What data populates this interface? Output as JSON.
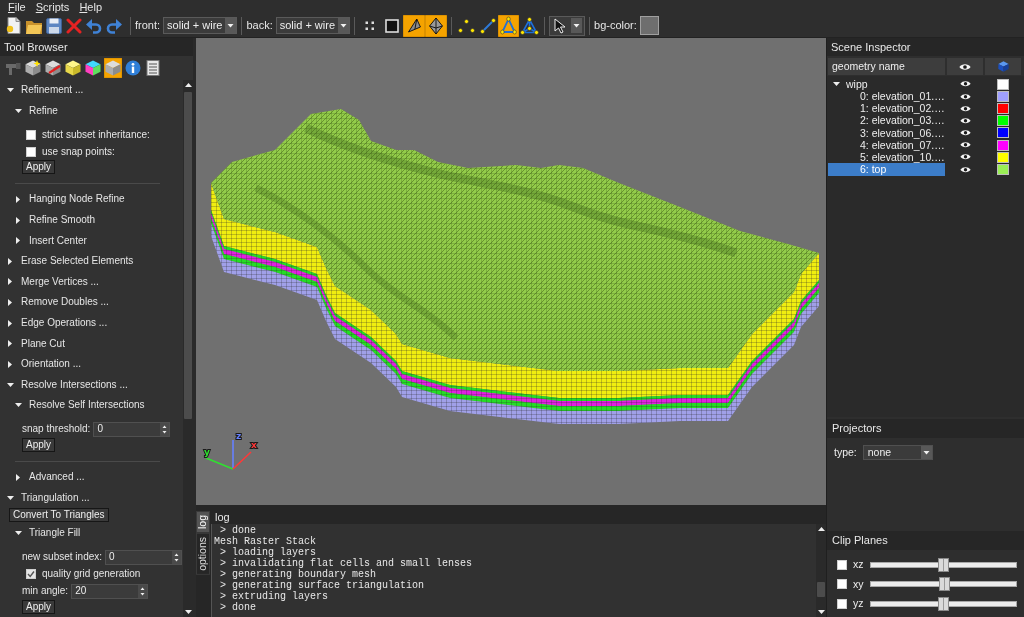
{
  "menu": [
    {
      "label": "File"
    },
    {
      "label": "Scripts"
    },
    {
      "label": "Help"
    }
  ],
  "toolbar": {
    "front": {
      "label": "front:",
      "value": "solid + wire"
    },
    "back": {
      "label": "back:",
      "value": "solid + wire"
    },
    "display_modes": [
      {
        "selected": false
      },
      {
        "selected": false
      },
      {
        "selected": true
      },
      {
        "selected": true
      }
    ],
    "selection_modes": [
      {
        "selected": false
      },
      {
        "selected": false
      },
      {
        "selected": true
      },
      {
        "selected": false
      }
    ],
    "bg_color_label": "bg-color:"
  },
  "tool_browser": {
    "title": "Tool Browser",
    "tool_tabs": [
      {
        "selected": false
      },
      {
        "selected": false
      },
      {
        "selected": false
      },
      {
        "selected": false
      },
      {
        "selected": false
      },
      {
        "selected": true
      },
      {
        "selected": false
      },
      {
        "selected": false
      }
    ],
    "tree": [
      {
        "kind": "group",
        "label": "Refinement ...",
        "expanded": true,
        "children": [
          {
            "kind": "group",
            "label": "Refine",
            "expanded": true,
            "children": [
              {
                "kind": "checkbox",
                "label": "strict subset inheritance:",
                "checked": false
              },
              {
                "kind": "checkbox",
                "label": "use snap points:",
                "checked": false
              },
              {
                "kind": "button",
                "label": "Apply"
              }
            ]
          },
          {
            "kind": "separator"
          },
          {
            "kind": "group",
            "label": "Hanging Node Refine",
            "expanded": false
          },
          {
            "kind": "group",
            "label": "Refine Smooth",
            "expanded": false
          },
          {
            "kind": "group",
            "label": "Insert Center",
            "expanded": false
          }
        ]
      },
      {
        "kind": "group",
        "label": "Erase Selected Elements",
        "expanded": false
      },
      {
        "kind": "group",
        "label": "Merge Vertices ...",
        "expanded": false
      },
      {
        "kind": "group",
        "label": "Remove Doubles ...",
        "expanded": false
      },
      {
        "kind": "group",
        "label": "Edge Operations ...",
        "expanded": false
      },
      {
        "kind": "group",
        "label": "Plane Cut",
        "expanded": false
      },
      {
        "kind": "group",
        "label": "Orientation ...",
        "expanded": false
      },
      {
        "kind": "group",
        "label": "Resolve Intersections ...",
        "expanded": true,
        "children": [
          {
            "kind": "group",
            "label": "Resolve Self Intersections",
            "expanded": true,
            "children": [
              {
                "kind": "spinbox",
                "label": "snap threshold:",
                "value": "0"
              },
              {
                "kind": "button",
                "label": "Apply"
              }
            ]
          },
          {
            "kind": "separator"
          },
          {
            "kind": "group",
            "label": "Advanced ...",
            "expanded": false
          }
        ]
      },
      {
        "kind": "group",
        "label": "Triangulation ...",
        "expanded": true,
        "children": [
          {
            "kind": "button",
            "label": "Convert To Triangles"
          },
          {
            "kind": "group",
            "label": "Triangle Fill",
            "expanded": true,
            "children": [
              {
                "kind": "spinbox",
                "label": "new subset index:",
                "value": "0"
              },
              {
                "kind": "checkbox",
                "label": "quality grid generation",
                "checked": true
              },
              {
                "kind": "spinbox",
                "label": "min angle:",
                "value": "20"
              },
              {
                "kind": "button",
                "label": "Apply"
              }
            ]
          }
        ]
      }
    ]
  },
  "viewport": {
    "axes": [
      {
        "label": "z",
        "color": "#6680ff"
      },
      {
        "label": "y",
        "color": "#30e030"
      },
      {
        "label": "x",
        "color": "#ff3838"
      }
    ]
  },
  "log_panel": {
    "side_tabs": [
      {
        "label": "log",
        "selected": true
      },
      {
        "label": "options",
        "selected": false
      }
    ],
    "title": "log",
    "lines": [
      " > done",
      "Mesh Raster Stack",
      " > loading layers",
      " > invalidating flat cells and small lenses",
      " > generating boundary mesh",
      " > generating surface triangulation",
      " > extruding layers",
      " > done"
    ]
  },
  "scene_inspector": {
    "title": "Scene Inspector",
    "columns": [
      {
        "label": "geometry name"
      }
    ],
    "tree": [
      {
        "name": "wipp",
        "expanded": true,
        "visible": true,
        "color": "#ffffff",
        "selected": false,
        "children": [
          {
            "name": "0: elevation_01.…",
            "visible": true,
            "color": "#a0a0ff",
            "selected": false
          },
          {
            "name": "1: elevation_02.…",
            "visible": true,
            "color": "#ff0000",
            "selected": false
          },
          {
            "name": "2: elevation_03.…",
            "visible": true,
            "color": "#00ff00",
            "selected": false
          },
          {
            "name": "3: elevation_06.…",
            "visible": true,
            "color": "#0000ff",
            "selected": false
          },
          {
            "name": "4: elevation_07.…",
            "visible": true,
            "color": "#ff00ff",
            "selected": false
          },
          {
            "name": "5: elevation_10.…",
            "visible": true,
            "color": "#ffff00",
            "selected": false
          },
          {
            "name": "6: top",
            "visible": true,
            "color": "#99ee55",
            "selected": true
          }
        ]
      }
    ]
  },
  "projectors": {
    "title": "Projectors",
    "type_label": "type:",
    "type_value": "none"
  },
  "clip_planes": {
    "title": "Clip Planes",
    "planes": [
      {
        "label": "xz",
        "checked": false,
        "level": 0.5
      },
      {
        "label": "xy",
        "checked": false,
        "level": 0.51
      },
      {
        "label": "yz",
        "checked": false,
        "level": 0.5
      }
    ]
  }
}
